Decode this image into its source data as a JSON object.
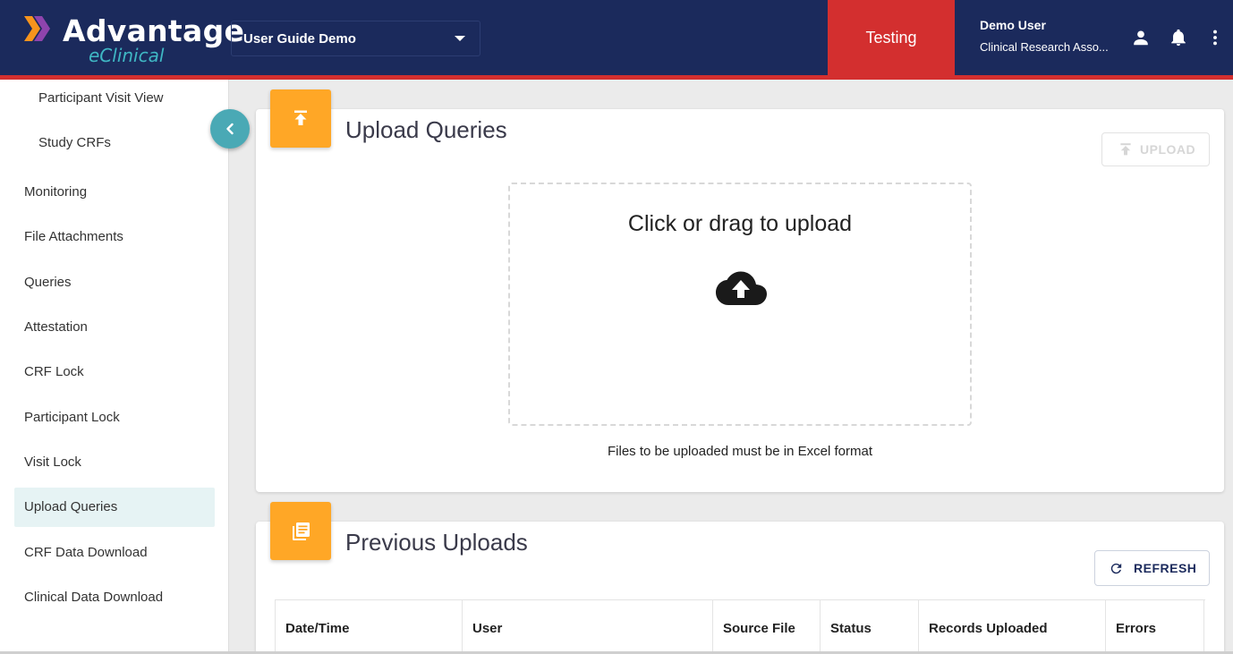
{
  "app": {
    "brand_name": "Advantage",
    "brand_sub": "eClinical",
    "colors": {
      "header": "#1b2a5c",
      "accent_red": "#d32f2f",
      "teal": "#4aa9b5",
      "orange": "#ffa726"
    }
  },
  "header": {
    "study_select": {
      "value": "User Guide Demo"
    },
    "environment": "Testing",
    "user": {
      "name": "Demo User",
      "role": "Clinical Research Asso..."
    },
    "icons": [
      "account-icon",
      "bell-icon",
      "more-vert-icon"
    ]
  },
  "sidebar": {
    "items": [
      {
        "label": "Participant Visit View",
        "sub": true
      },
      {
        "label": "Study CRFs",
        "sub": true
      },
      {
        "label": "Monitoring"
      },
      {
        "label": "File Attachments"
      },
      {
        "label": "Queries"
      },
      {
        "label": "Attestation"
      },
      {
        "label": "CRF Lock"
      },
      {
        "label": "Participant Lock"
      },
      {
        "label": "Visit Lock"
      },
      {
        "label": "Upload Queries",
        "active": true
      },
      {
        "label": "CRF Data Download"
      },
      {
        "label": "Clinical Data Download"
      }
    ]
  },
  "upload_card": {
    "title": "Upload Queries",
    "upload_button": "UPLOAD",
    "dropzone_text": "Click or drag to upload",
    "hint": "Files to be uploaded must be in Excel format"
  },
  "previous_card": {
    "title": "Previous Uploads",
    "refresh_button": "REFRESH",
    "columns": [
      "Date/Time",
      "User",
      "Source File",
      "Status",
      "Records Uploaded",
      "Errors"
    ]
  }
}
